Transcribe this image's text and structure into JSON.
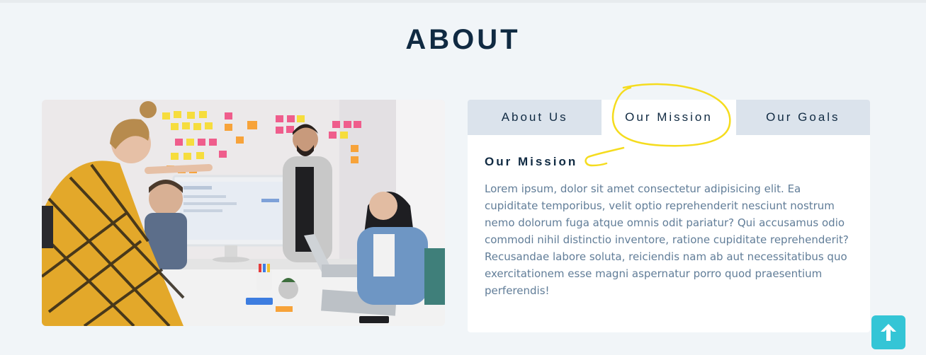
{
  "section": {
    "title": "ABOUT"
  },
  "photo": {
    "alt": "Team meeting in an office"
  },
  "tabs": [
    {
      "label": "About Us",
      "active": false
    },
    {
      "label": "Our Mission",
      "active": true
    },
    {
      "label": "Our Goals",
      "active": false
    }
  ],
  "content": {
    "heading": "Our Mission",
    "text": "Lorem ipsum, dolor sit amet consectetur adipisicing elit. Ea cupiditate temporibus, velit optio reprehenderit nesciunt nostrum nemo dolorum fuga atque omnis odit pariatur? Qui accusamus odio commodi nihil distinctio inventore, ratione cupiditate reprehenderit? Recusandae labore soluta, reiciendis nam ab aut necessitatibus quo exercitationem esse magni aspernatur porro quod praesentium perferendis!"
  },
  "scroll_top": {
    "icon": "arrow-up-icon"
  },
  "colors": {
    "background": "#f1f5f8",
    "title": "#102a42",
    "tab_inactive": "#dbe3ec",
    "body_text": "#617d98",
    "accent": "#34c5d6",
    "annotation": "#f5dc1e"
  }
}
